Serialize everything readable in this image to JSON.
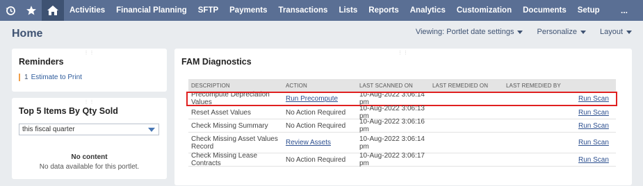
{
  "nav": {
    "items": [
      "Activities",
      "Financial Planning",
      "SFTP",
      "Payments",
      "Transactions",
      "Lists",
      "Reports",
      "Analytics",
      "Customization",
      "Documents",
      "Setup"
    ],
    "more": "..."
  },
  "page": {
    "title": "Home",
    "viewing": "Viewing: Portlet date settings",
    "personalize": "Personalize",
    "layout": "Layout"
  },
  "reminders": {
    "title": "Reminders",
    "count": "1",
    "link": "Estimate to Print"
  },
  "topitems": {
    "title": "Top 5 Items By Qty Sold",
    "filter_value": "this fiscal quarter",
    "no_content_title": "No content",
    "no_content_message": "No data available for this portlet."
  },
  "fam": {
    "title": "FAM Diagnostics",
    "columns": [
      "DESCRIPTION",
      "ACTION",
      "LAST SCANNED ON",
      "LAST REMEDIED ON",
      "LAST REMEDIED BY",
      ""
    ],
    "rows": [
      {
        "description": "Precompute Depreciation Values",
        "action": "Run Precompute",
        "action_is_link": true,
        "last_scanned": "10-Aug-2022 3:06:14 pm",
        "last_remedied_on": "",
        "last_remedied_by": "",
        "scan": "Run Scan"
      },
      {
        "description": "Reset Asset Values",
        "action": "No Action Required",
        "action_is_link": false,
        "last_scanned": "10-Aug-2022 3:06:13 pm",
        "last_remedied_on": "",
        "last_remedied_by": "",
        "scan": "Run Scan"
      },
      {
        "description": "Check Missing Summary",
        "action": "No Action Required",
        "action_is_link": false,
        "last_scanned": "10-Aug-2022 3:06:16 pm",
        "last_remedied_on": "",
        "last_remedied_by": "",
        "scan": "Run Scan"
      },
      {
        "description": "Check Missing Asset Values Record",
        "action": "Review Assets",
        "action_is_link": true,
        "last_scanned": "10-Aug-2022 3:06:14 pm",
        "last_remedied_on": "",
        "last_remedied_by": "",
        "scan": "Run Scan"
      },
      {
        "description": "Check Missing Lease Contracts",
        "action": "No Action Required",
        "action_is_link": false,
        "last_scanned": "10-Aug-2022 3:06:17 pm",
        "last_remedied_on": "",
        "last_remedied_by": "",
        "scan": "Run Scan"
      }
    ]
  },
  "colors": {
    "nav_bg": "#5a6f94",
    "nav_active": "#3e5272",
    "highlight": "#e02020",
    "link": "#2c4f8f"
  }
}
